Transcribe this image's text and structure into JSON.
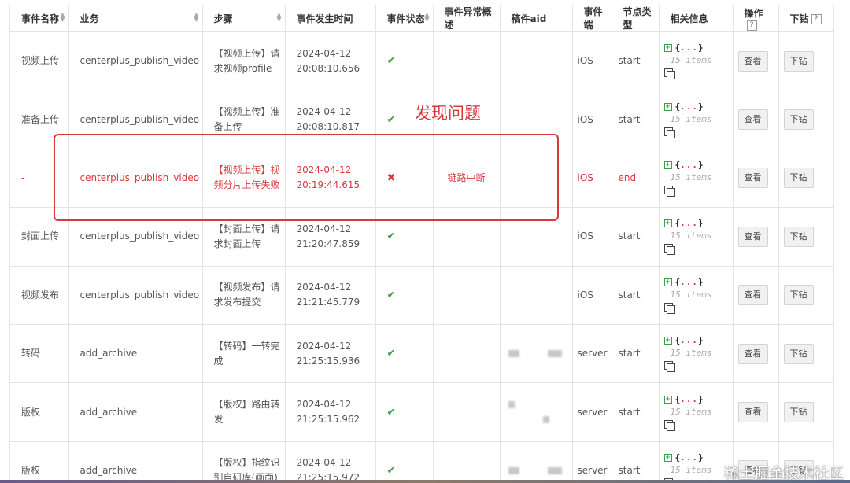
{
  "headers": [
    {
      "label": "事件名称",
      "sortable": true
    },
    {
      "label": "业务",
      "sortable": true
    },
    {
      "label": "步骤",
      "sortable": true
    },
    {
      "label": "事件发生时间",
      "sortable": false
    },
    {
      "label": "事件状态",
      "sortable": true
    },
    {
      "label": "事件异常概述",
      "sortable": false
    },
    {
      "label": "稿件aid",
      "sortable": false
    },
    {
      "label": "事件端",
      "sortable": false
    },
    {
      "label": "节点类型",
      "sortable": false
    },
    {
      "label": "相关信息",
      "sortable": false
    },
    {
      "label": "操作",
      "sortable": false,
      "help": "?"
    },
    {
      "label": "下钻",
      "sortable": false,
      "help": "?"
    }
  ],
  "rows": [
    {
      "name": "视频上传",
      "biz": "centerplus_publish_video",
      "step": "【视频上传】请求视频profile",
      "date": "2024-04-12",
      "time": "20:08:10.656",
      "status": "ok",
      "summary": "",
      "aid_masked": false,
      "client": "iOS",
      "node": "start",
      "error": false
    },
    {
      "name": "准备上传",
      "biz": "centerplus_publish_video",
      "step": "【视频上传】准备上传",
      "date": "2024-04-12",
      "time": "20:08:10.817",
      "status": "ok",
      "summary": "",
      "aid_masked": false,
      "client": "iOS",
      "node": "start",
      "error": false
    },
    {
      "name": "-",
      "biz": "centerplus_publish_video",
      "step": "【视频上传】视频分片上传失败",
      "date": "2024-04-12",
      "time": "20:19:44.615",
      "status": "error",
      "summary": "链路中断",
      "aid_masked": false,
      "client": "iOS",
      "node": "end",
      "error": true
    },
    {
      "name": "封面上传",
      "biz": "centerplus_publish_video",
      "step": "【封面上传】请求封面上传",
      "date": "2024-04-12",
      "time": "21:20:47.859",
      "status": "ok",
      "summary": "",
      "aid_masked": false,
      "client": "iOS",
      "node": "start",
      "error": false
    },
    {
      "name": "视频发布",
      "biz": "centerplus_publish_video",
      "step": "【视频发布】请求发布提交",
      "date": "2024-04-12",
      "time": "21:21:45.779",
      "status": "ok",
      "summary": "",
      "aid_masked": false,
      "client": "iOS",
      "node": "start",
      "error": false
    },
    {
      "name": "转码",
      "biz": "add_archive",
      "step": "【转码】一转完成",
      "date": "2024-04-12",
      "time": "21:25:15.936",
      "status": "ok",
      "summary": "",
      "aid_masked": true,
      "client": "server",
      "node": "start",
      "error": false
    },
    {
      "name": "版权",
      "biz": "add_archive",
      "step": "【版权】路由转发",
      "date": "2024-04-12",
      "time": "21:25:15.962",
      "status": "ok",
      "summary": "",
      "aid_masked": true,
      "client": "server",
      "node": "start",
      "error": false
    },
    {
      "name": "版权",
      "biz": "add_archive",
      "step": "【版权】指纹识别自研库(画面)",
      "date": "2024-04-12",
      "time": "21:25:15.972",
      "status": "ok",
      "summary": "",
      "aid_masked": true,
      "client": "server",
      "node": "start",
      "error": false
    }
  ],
  "info": {
    "open_brace": "{",
    "dots": "...",
    "close_brace": "}",
    "items_text": "15 items"
  },
  "buttons": {
    "view": "查看",
    "drill": "下钻"
  },
  "status_icons": {
    "ok": "✔",
    "error": "✖"
  },
  "annotation": {
    "label": "发现问题",
    "color": "#d9383c"
  },
  "watermark": "稀土掘金技术社区",
  "colors": {
    "ok": "#3aa14b",
    "error": "#d9383c"
  }
}
